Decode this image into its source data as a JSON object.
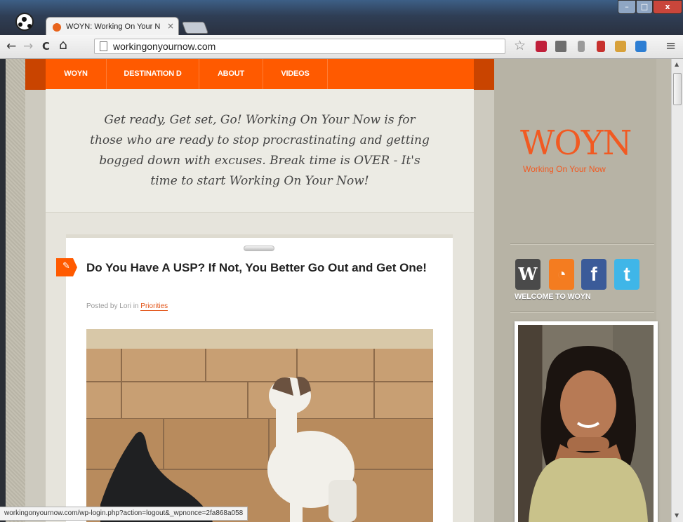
{
  "browser": {
    "tab_title": "WOYN: Working On Your N",
    "tab_close": "×",
    "url": "workingonyournow.com",
    "status_url": "workingonyournow.com/wp-login.php?action=logout&_wpnonce=2fa868a058",
    "window_controls": {
      "minimize": "–",
      "maximize": "□",
      "close": "x"
    },
    "nav": {
      "back": "←",
      "forward": "→",
      "reload": "C",
      "home": "⌂"
    },
    "star": "☆",
    "menu": "≡",
    "extension_icons": [
      "lastpass-icon",
      "evernote-icon",
      "extension-icon",
      "bookmark-icon",
      "notes-icon",
      "screen-capture-icon"
    ],
    "accent": "#ff5a00"
  },
  "site": {
    "nav_items": [
      "WOYN",
      "DESTINATION D",
      "ABOUT",
      "VIDEOS"
    ],
    "tagline": "Get ready, Get set, Go! Working On Your Now is for those who are ready to stop procrastinating and getting bogged down with excuses. Break time is OVER - It's time to start Working On Your Now!",
    "post": {
      "title": "Do You Have A USP? If Not, You Better Go Out and Get One!",
      "meta_prefix": "Posted by Lori in",
      "category": "Priorities"
    },
    "sidebar": {
      "logo": "WOYN",
      "logo_sub": "Working On Your Now",
      "social": [
        {
          "name": "wordpress",
          "glyph": "W",
          "color": "#4a4a4a"
        },
        {
          "name": "rss",
          "glyph": "☷",
          "color": "#f47c20"
        },
        {
          "name": "facebook",
          "glyph": "f",
          "color": "#3b5b99"
        },
        {
          "name": "twitter",
          "glyph": "t",
          "color": "#3fb6e8"
        }
      ],
      "welcome": "WELCOME TO WOYN"
    }
  }
}
